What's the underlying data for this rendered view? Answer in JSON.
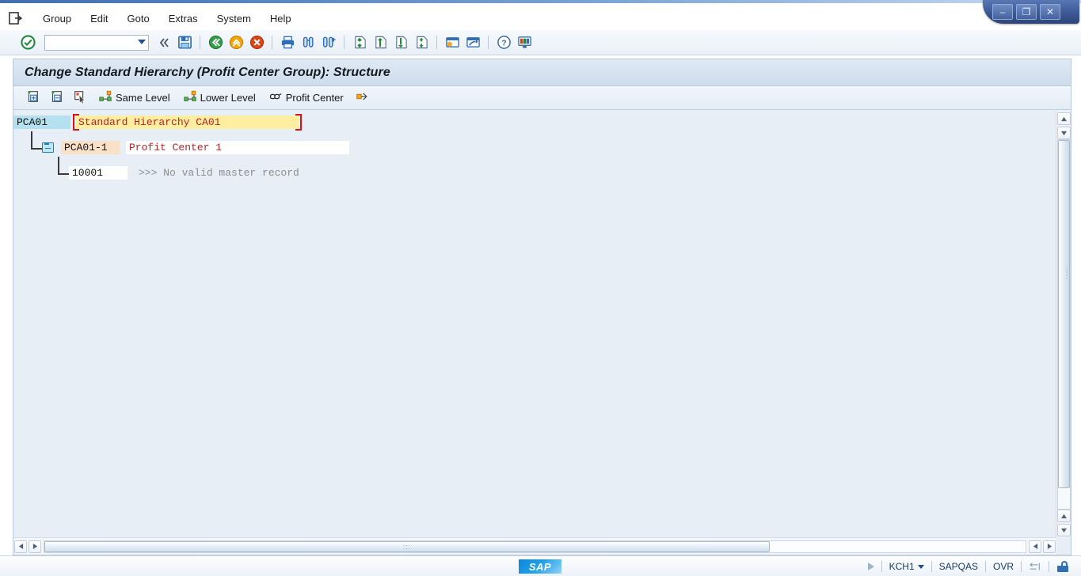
{
  "window": {
    "controls": [
      {
        "name": "minimize",
        "glyph": "–"
      },
      {
        "name": "restore",
        "glyph": "❐"
      },
      {
        "name": "close",
        "glyph": "✕"
      }
    ]
  },
  "menubar": {
    "system_icon": "session-menu-icon",
    "items": [
      {
        "label": "Group",
        "accel": "r"
      },
      {
        "label": "Edit",
        "accel": "E"
      },
      {
        "label": "Goto",
        "accel": "G"
      },
      {
        "label": "Extras",
        "accel": "a"
      },
      {
        "label": "System",
        "accel": "y"
      },
      {
        "label": "Help",
        "accel": "H"
      }
    ]
  },
  "toolbar": {
    "enter_icon": "enter-check-icon",
    "command_field": {
      "value": "",
      "placeholder": ""
    },
    "collapse_icon": "collapse-left-icon",
    "items": [
      "save-icon",
      "back-icon",
      "exit-icon",
      "cancel-icon",
      "print-icon",
      "find-icon",
      "find-next-icon",
      "first-page-icon",
      "previous-page-icon",
      "next-page-icon",
      "last-page-icon",
      "create-session-icon",
      "create-shortcut-icon",
      "help-icon",
      "customize-layout-icon"
    ]
  },
  "page": {
    "title": "Change Standard Hierarchy (Profit Center Group): Structure"
  },
  "app_toolbar": {
    "buttons": [
      {
        "name": "expand-node",
        "label": "",
        "icon": "expand-node-icon"
      },
      {
        "name": "collapse-node",
        "label": "",
        "icon": "collapse-node-icon"
      },
      {
        "name": "select-node",
        "label": "",
        "icon": "select-pointer-icon"
      },
      {
        "name": "same-level",
        "label": "Same Level",
        "icon": "same-level-icon"
      },
      {
        "name": "lower-level",
        "label": "Lower Level",
        "icon": "lower-level-icon"
      },
      {
        "name": "profit-center",
        "label": "Profit Center",
        "icon": "profit-center-icon"
      },
      {
        "name": "move-node",
        "label": "",
        "icon": "move-node-icon"
      }
    ]
  },
  "tree": {
    "nodes": [
      {
        "key": "PCA01",
        "description": "Standard Hierarchy CA01",
        "level": 0,
        "key_style": "selected",
        "desc_style": "yellow",
        "has_cursor": true,
        "has_folder": false
      },
      {
        "key": "PCA01-1",
        "description": "Profit Center 1",
        "level": 1,
        "key_style": "peach",
        "desc_style": "white",
        "has_cursor": false,
        "has_folder": true
      },
      {
        "key": "10001",
        "description": ">>> No valid master record",
        "level": 2,
        "key_style": "white",
        "desc_style": "plain",
        "has_cursor": false,
        "has_folder": false
      }
    ]
  },
  "scrollbars": {
    "vertical": {
      "up": "▲",
      "down": "▼"
    },
    "horizontal": {
      "left": "◀",
      "right": "▶",
      "grip": ":::"
    }
  },
  "statusbar": {
    "logo": "SAP",
    "ready_icon": "ready-play-icon",
    "transaction": "KCH1",
    "system": "SAPQAS",
    "insert_mode": "OVR",
    "resize_icon": "resize-grip-icon",
    "lock_icon": "unlocked-icon"
  }
}
